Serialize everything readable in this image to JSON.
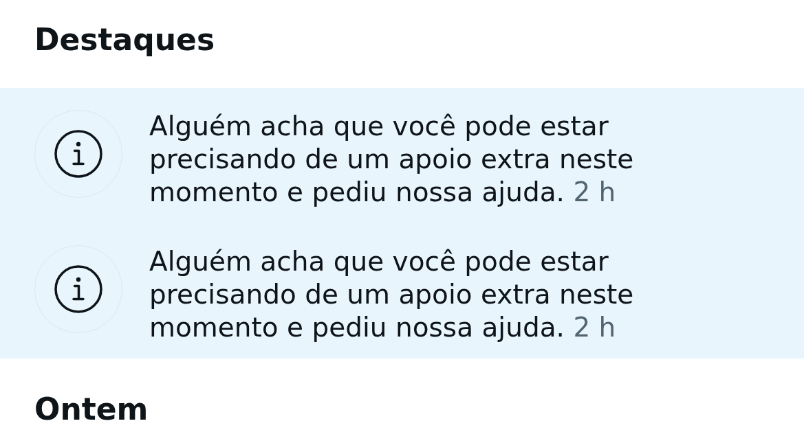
{
  "sections": [
    {
      "title": "Destaques",
      "notifications": [
        {
          "unread": true,
          "message": "Alguém acha que você pode estar precisando de um apoio extra neste momento e pediu nossa ajuda.",
          "time": "2 h"
        },
        {
          "unread": true,
          "message": "Alguém acha que você pode estar precisando de um apoio extra neste momento e pediu nossa ajuda.",
          "time": "2 h"
        }
      ]
    },
    {
      "title": "Ontem"
    }
  ]
}
